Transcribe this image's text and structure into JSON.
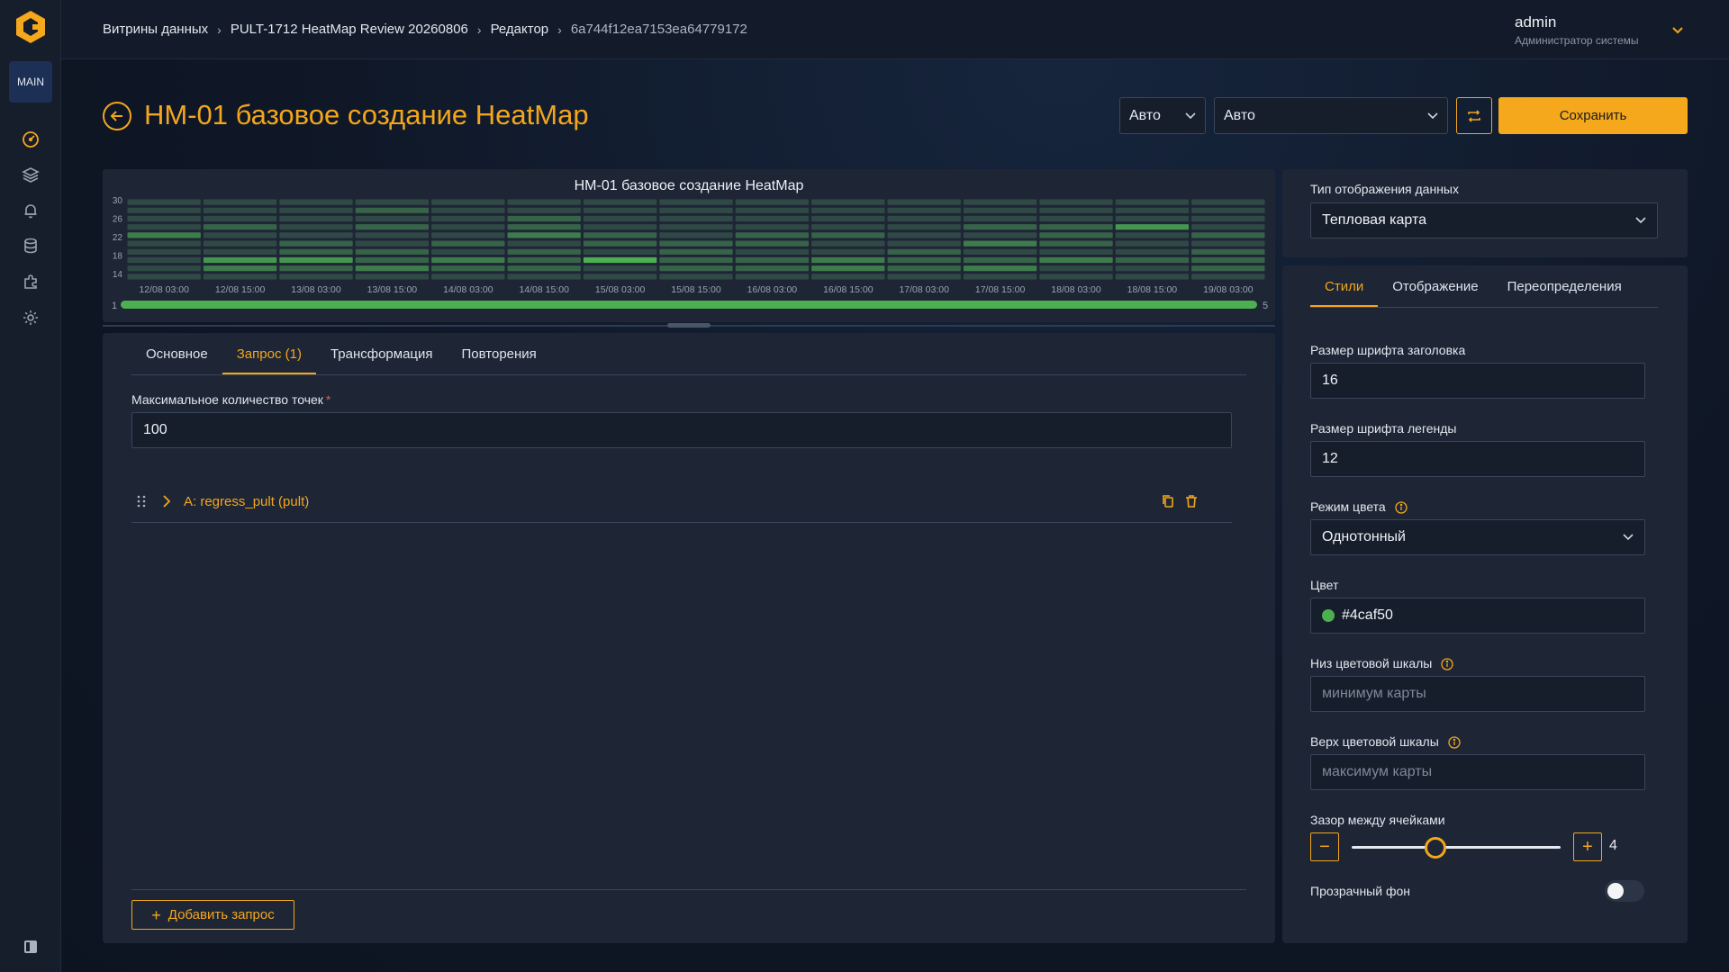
{
  "workspace_badge": "MAIN",
  "sidebar": {
    "items": [
      {
        "icon": "dashboard-icon"
      },
      {
        "icon": "layers-icon"
      },
      {
        "icon": "bell-icon"
      },
      {
        "icon": "database-icon"
      },
      {
        "icon": "plugin-icon"
      },
      {
        "icon": "settings-gear-icon"
      }
    ]
  },
  "breadcrumbs": [
    "Витрины данных",
    "PULT-1712 HeatMap Review 20260806",
    "Редактор",
    "6a744f12ea7153ea64779172"
  ],
  "user": {
    "name": "admin",
    "role": "Администратор системы"
  },
  "page": {
    "title": "HM-01 базовое создание HeatMap"
  },
  "toolbar": {
    "select_small": "Авто",
    "select_large": "Авто",
    "save_label": "Сохранить"
  },
  "chart_data": {
    "type": "heatmap",
    "title": "HM-01 базовое создание HeatMap",
    "y_ticks": [
      "30",
      "26",
      "22",
      "18",
      "14"
    ],
    "x_ticks": [
      "12/08 03:00",
      "12/08 15:00",
      "13/08 03:00",
      "13/08 15:00",
      "14/08 03:00",
      "14/08 15:00",
      "15/08 03:00",
      "15/08 15:00",
      "16/08 03:00",
      "16/08 15:00",
      "17/08 03:00",
      "17/08 15:00",
      "18/08 03:00",
      "18/08 15:00",
      "19/08 03:00"
    ],
    "color": "#4caf50",
    "legend_min": "1",
    "legend_max": "5",
    "rows_top_to_bottom": 10,
    "values": [
      [
        1,
        1,
        1,
        1,
        1,
        1,
        1,
        1,
        1,
        1,
        1,
        1,
        1,
        1,
        1
      ],
      [
        1,
        1,
        1,
        2,
        1,
        1,
        1,
        1,
        1,
        1,
        1,
        1,
        1,
        1,
        1
      ],
      [
        1,
        1,
        1,
        1,
        1,
        2,
        1,
        1,
        1,
        1,
        1,
        1,
        1,
        1,
        1
      ],
      [
        1,
        2,
        1,
        2,
        1,
        2,
        1,
        1,
        1,
        1,
        1,
        2,
        2,
        4,
        1
      ],
      [
        3,
        1,
        1,
        1,
        1,
        3,
        2,
        1,
        2,
        2,
        1,
        1,
        2,
        1,
        2
      ],
      [
        1,
        1,
        2,
        1,
        2,
        1,
        2,
        2,
        2,
        1,
        1,
        3,
        2,
        1,
        1
      ],
      [
        1,
        1,
        2,
        2,
        1,
        2,
        1,
        2,
        1,
        1,
        2,
        1,
        1,
        1,
        2
      ],
      [
        1,
        4,
        4,
        2,
        3,
        2,
        5,
        2,
        2,
        3,
        2,
        2,
        3,
        2,
        2
      ],
      [
        1,
        3,
        2,
        3,
        2,
        2,
        1,
        2,
        2,
        3,
        2,
        3,
        1,
        1,
        2
      ],
      [
        1,
        1,
        1,
        1,
        1,
        1,
        1,
        1,
        1,
        1,
        1,
        1,
        1,
        1,
        1
      ]
    ]
  },
  "editor": {
    "tabs": [
      "Основное",
      "Запрос (1)",
      "Трансформация",
      "Повторения"
    ],
    "active_tab": 1,
    "max_points_label": "Максимальное количество точек",
    "max_points_required": "*",
    "max_points_value": "100",
    "query_label": "A: regress_pult (pult)",
    "add_query_label": "Добавить запрос"
  },
  "display_type": {
    "label": "Тип отображения данных",
    "value": "Тепловая карта"
  },
  "settings": {
    "tabs": [
      "Стили",
      "Отображение",
      "Переопределения"
    ],
    "active_tab": 0,
    "title_font_label": "Размер шрифта заголовка",
    "title_font_value": "16",
    "legend_font_label": "Размер шрифта легенды",
    "legend_font_value": "12",
    "color_mode_label": "Режим цвета",
    "color_mode_value": "Однотонный",
    "color_label": "Цвет",
    "color_value": "#4caf50",
    "scale_min_label": "Низ цветовой шкалы",
    "scale_min_placeholder": "минимум карты",
    "scale_max_label": "Верх цветовой шкалы",
    "scale_max_placeholder": "максимум карты",
    "cell_gap_label": "Зазор между ячейками",
    "cell_gap_value": "4",
    "cell_gap_fraction": 0.4,
    "transparent_bg_label": "Прозрачный фон",
    "transparent_bg_on": false
  },
  "colors": {
    "accent": "#f3a61c",
    "panel": "#1e2636",
    "heat": "#4caf50"
  }
}
